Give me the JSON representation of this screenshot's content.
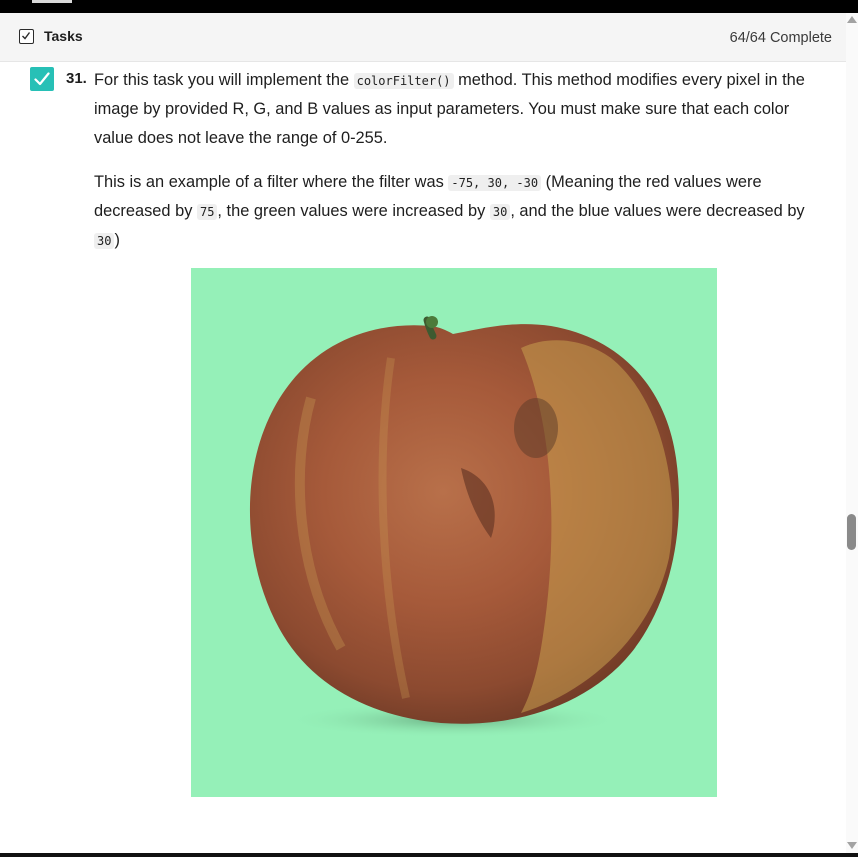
{
  "header": {
    "title": "Tasks",
    "progress": "64/64 Complete"
  },
  "task": {
    "number": "31.",
    "p1_text1": "For this task you will implement the ",
    "p1_code": "colorFilter()",
    "p1_text2": " method. This method modifies every pixel in the image by provided R, G, and B values as input parameters. You must make sure that each color value does not leave the range of 0-255.",
    "p2_text1": "This is an example of a filter where the filter was ",
    "p2_code1": "-75, 30, -30",
    "p2_text2": " (Meaning the red values were decreased by ",
    "p2_code2": "75",
    "p2_text3": ", the green values were increased by ",
    "p2_code3": "30",
    "p2_text4": ", and the blue values were decreased by ",
    "p2_code4": "30",
    "p2_text5": ")"
  },
  "colors": {
    "accent_check": "#27c0b6",
    "image_background": "#95f0b8"
  },
  "icons": {
    "header_checkbox": "checkbox-checked-icon",
    "task_complete": "checkmark-icon",
    "scroll_up": "triangle-up-icon",
    "scroll_down": "triangle-down-icon"
  }
}
